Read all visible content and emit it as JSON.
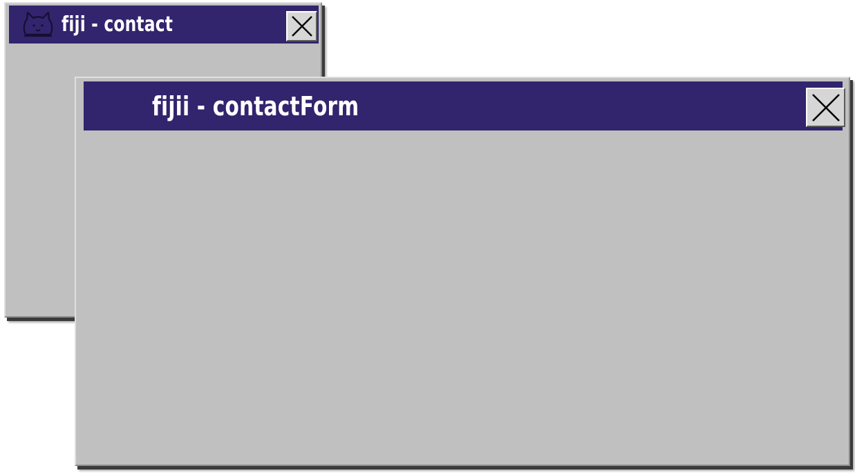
{
  "windows": [
    {
      "title": "fiji - contact",
      "logo_icon": "cat-icon",
      "close_icon": "close-icon"
    },
    {
      "title": "fijii - contactForm",
      "close_icon": "close-icon"
    }
  ],
  "colors": {
    "titlebar": "#32246d",
    "window_body": "#c0c0c0",
    "title_text": "#ffffff"
  }
}
